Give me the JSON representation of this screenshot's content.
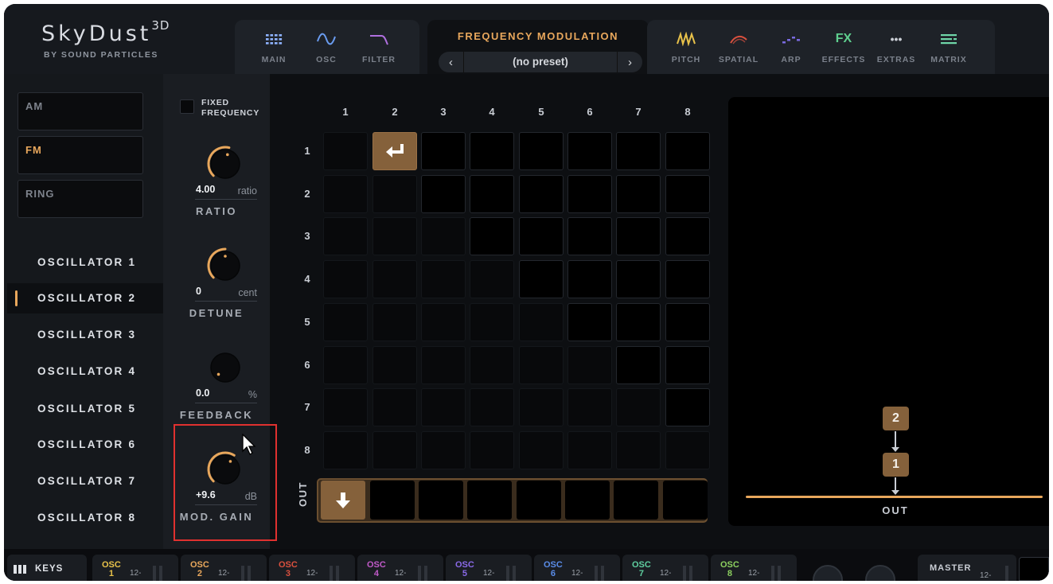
{
  "logo": {
    "title": "SkyDust",
    "superscript": "3D",
    "subtitle": "BY SOUND PARTICLES"
  },
  "nav_left": [
    {
      "label": "MAIN",
      "icon": "main-grid-icon",
      "color": "#8fb4ff"
    },
    {
      "label": "OSC",
      "icon": "sine-wave-icon",
      "color": "#6a9cf0"
    },
    {
      "label": "FILTER",
      "icon": "filter-curve-icon",
      "color": "#b070e0"
    }
  ],
  "nav_right": [
    {
      "label": "PITCH",
      "icon": "pitch-wave-icon",
      "color": "#e8c24a"
    },
    {
      "label": "SPATIAL",
      "icon": "spatial-icon",
      "color": "#d9503e"
    },
    {
      "label": "ARP",
      "icon": "arp-icon",
      "color": "#7a6ae0"
    },
    {
      "label": "EFFECTS",
      "icon": "fx-icon",
      "icon_text": "FX",
      "color": "#5fcf8f"
    },
    {
      "label": "EXTRAS",
      "icon": "more-dots-icon",
      "icon_text": "•••",
      "color": "#c9cdd4"
    },
    {
      "label": "MATRIX",
      "icon": "matrix-icon",
      "color": "#6fd6a8"
    }
  ],
  "module": {
    "title": "FREQUENCY MODULATION",
    "preset": "(no preset)",
    "prev": "‹",
    "next": "›"
  },
  "modes": [
    {
      "label": "AM",
      "active": false
    },
    {
      "label": "FM",
      "active": true
    },
    {
      "label": "RING",
      "active": false
    }
  ],
  "oscillators": [
    {
      "label": "OSCILLATOR 1",
      "active": false
    },
    {
      "label": "OSCILLATOR 2",
      "active": true
    },
    {
      "label": "OSCILLATOR 3",
      "active": false
    },
    {
      "label": "OSCILLATOR 4",
      "active": false
    },
    {
      "label": "OSCILLATOR 5",
      "active": false
    },
    {
      "label": "OSCILLATOR 6",
      "active": false
    },
    {
      "label": "OSCILLATOR 7",
      "active": false
    },
    {
      "label": "OSCILLATOR 8",
      "active": false
    }
  ],
  "params": {
    "fixed_frequency": {
      "label": "FIXED\nFREQUENCY",
      "checked": false
    },
    "knobs": [
      {
        "name": "RATIO",
        "value": "4.00",
        "unit": "ratio",
        "level": 0.55,
        "icon": "ratio-knob"
      },
      {
        "name": "DETUNE",
        "value": "0",
        "unit": "cent",
        "level": 0.5,
        "icon": "detune-knob"
      },
      {
        "name": "FEEDBACK",
        "value": "0.0",
        "unit": "%",
        "level": 0.0,
        "icon": "feedback-knob"
      },
      {
        "name": "MOD. GAIN",
        "value": "+9.6",
        "unit": "dB",
        "level": 0.62,
        "icon": "mod-gain-knob"
      }
    ]
  },
  "matrix": {
    "columns": [
      "1",
      "2",
      "3",
      "4",
      "5",
      "6",
      "7",
      "8"
    ],
    "rows": [
      "1",
      "2",
      "3",
      "4",
      "5",
      "6",
      "7",
      "8"
    ],
    "active_cells": [
      {
        "row": 1,
        "col": 2,
        "icon": "return-arrow-icon"
      }
    ],
    "out_label": "OUT",
    "out_active": [
      1
    ]
  },
  "routing": {
    "nodes": [
      "2",
      "1"
    ],
    "out_label": "OUT"
  },
  "bottom": {
    "keys_label": "KEYS",
    "osc_strips": [
      {
        "label": "OSC",
        "num": "1",
        "color": "#e8c24a",
        "value": "12-"
      },
      {
        "label": "OSC",
        "num": "2",
        "color": "#e8a75c",
        "value": "12-"
      },
      {
        "label": "OSC",
        "num": "3",
        "color": "#d9503e",
        "value": "12-"
      },
      {
        "label": "OSC",
        "num": "4",
        "color": "#c05ac8",
        "value": "12-"
      },
      {
        "label": "OSC",
        "num": "5",
        "color": "#8a6ae8",
        "value": "12-"
      },
      {
        "label": "OSC",
        "num": "6",
        "color": "#5a8ce8",
        "value": "12-"
      },
      {
        "label": "OSC",
        "num": "7",
        "color": "#5fcfa0",
        "value": "12-"
      },
      {
        "label": "OSC",
        "num": "8",
        "color": "#8ccf5f",
        "value": "12-"
      }
    ],
    "master": {
      "label": "MASTER",
      "value": "12-"
    }
  },
  "colors": {
    "accent": "#e8a75c",
    "highlight_box": "#e0312f",
    "active_cell": "#85613b"
  }
}
